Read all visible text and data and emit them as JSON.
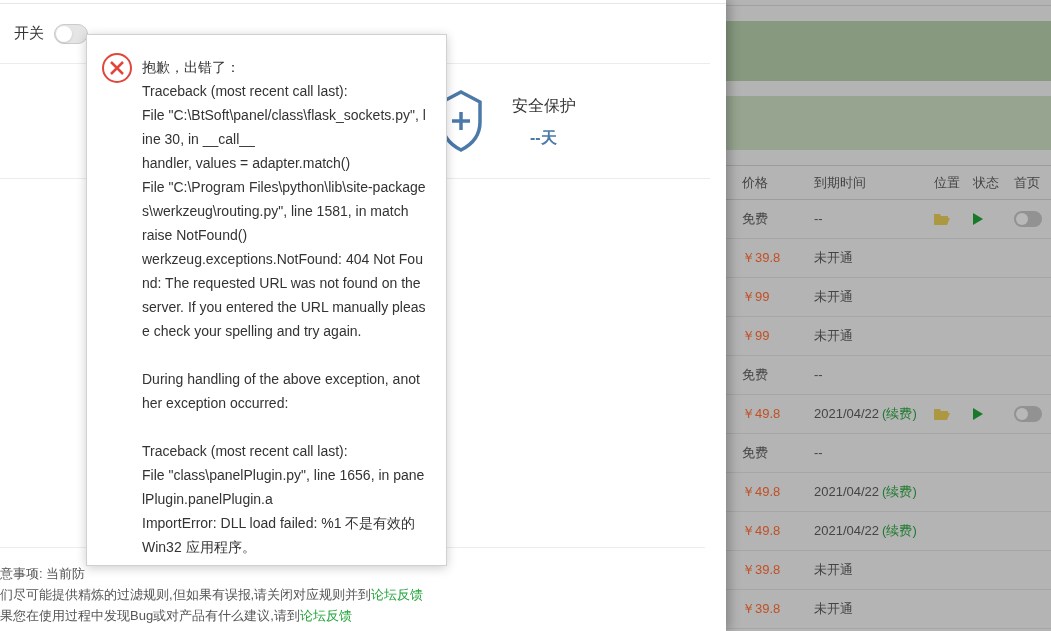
{
  "firewall_switch": {
    "label": "开关",
    "on": false
  },
  "protection": {
    "title": "安全保护",
    "days": "--天"
  },
  "notes": [
    {
      "text": "意事项: 当前防"
    },
    {
      "text": "们尽可能提供精炼的过滤规则,但如果有误报,请关闭对应规则并到",
      "link": "论坛反馈"
    },
    {
      "text": "果您在使用过程中发现Bug或对产品有什么建议,请到",
      "link": "论坛反馈"
    }
  ],
  "error_dialog": {
    "paragraphs": [
      [
        "抱歉，出错了：",
        "Traceback (most recent call last):",
        "File \"C:\\BtSoft\\panel/class\\flask_sockets.py\", l",
        "ine 30, in __call__",
        "handler, values = adapter.match()",
        "File \"C:\\Program Files\\python\\lib\\site-package",
        "s\\werkzeug\\routing.py\", line 1581, in match",
        "raise NotFound()",
        "werkzeug.exceptions.NotFound: 404 Not Fou",
        "nd: The requested URL was not found on the",
        "server. If you entered the URL manually pleas",
        "e check your spelling and try again."
      ],
      [
        "During handling of the above exception, anot",
        "her exception occurred:"
      ],
      [
        "Traceback (most recent call last):",
        "File \"class\\panelPlugin.py\", line 1656, in pane",
        "lPlugin.panelPlugin.a",
        "ImportError: DLL load failed: %1 不是有效的",
        "Win32 应用程序。"
      ]
    ]
  },
  "table": {
    "columns": [
      "价格",
      "到期时间",
      "位置",
      "状态",
      "首页"
    ],
    "rows": [
      {
        "price": "免费",
        "paid": false,
        "expiry": "--",
        "controls": true,
        "home_on": false
      },
      {
        "price": "￥39.8",
        "paid": true,
        "expiry": "未开通",
        "controls": false
      },
      {
        "price": "￥99",
        "paid": true,
        "expiry": "未开通",
        "controls": false
      },
      {
        "price": "￥99",
        "paid": true,
        "expiry": "未开通",
        "controls": false
      },
      {
        "price": "免费",
        "paid": false,
        "expiry": "--",
        "controls": false
      },
      {
        "price": "￥49.8",
        "paid": true,
        "expiry": "2021/04/22",
        "renew": "(续费)",
        "controls": true,
        "home_on": false
      },
      {
        "price": "免费",
        "paid": false,
        "expiry": "--",
        "controls": false
      },
      {
        "price": "￥49.8",
        "paid": true,
        "expiry": "2021/04/22",
        "renew": "(续费)",
        "controls": false
      },
      {
        "price": "￥49.8",
        "paid": true,
        "expiry": "2021/04/22",
        "renew": "(续费)",
        "controls": false
      },
      {
        "price": "￥39.8",
        "paid": true,
        "expiry": "未开通",
        "controls": false
      },
      {
        "price": "￥39.8",
        "paid": true,
        "expiry": "未开通",
        "controls": false
      }
    ]
  }
}
